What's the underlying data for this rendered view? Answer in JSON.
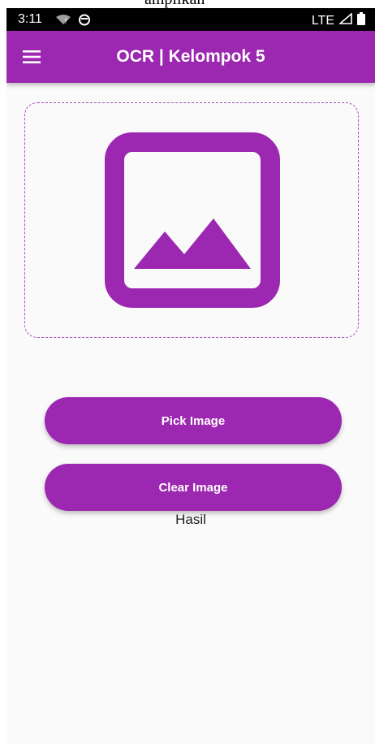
{
  "status_bar": {
    "time": "3:11",
    "network": "LTE"
  },
  "app_bar": {
    "title": "OCR | Kelompok 5"
  },
  "image_picker": {
    "icon": "image-placeholder-icon"
  },
  "buttons": {
    "pick_label": "Pick Image",
    "clear_label": "Clear Image"
  },
  "result": {
    "text": "Hasil"
  },
  "colors": {
    "primary": "#9c27b0",
    "background": "#fafafa",
    "status_bar": "#000000"
  }
}
